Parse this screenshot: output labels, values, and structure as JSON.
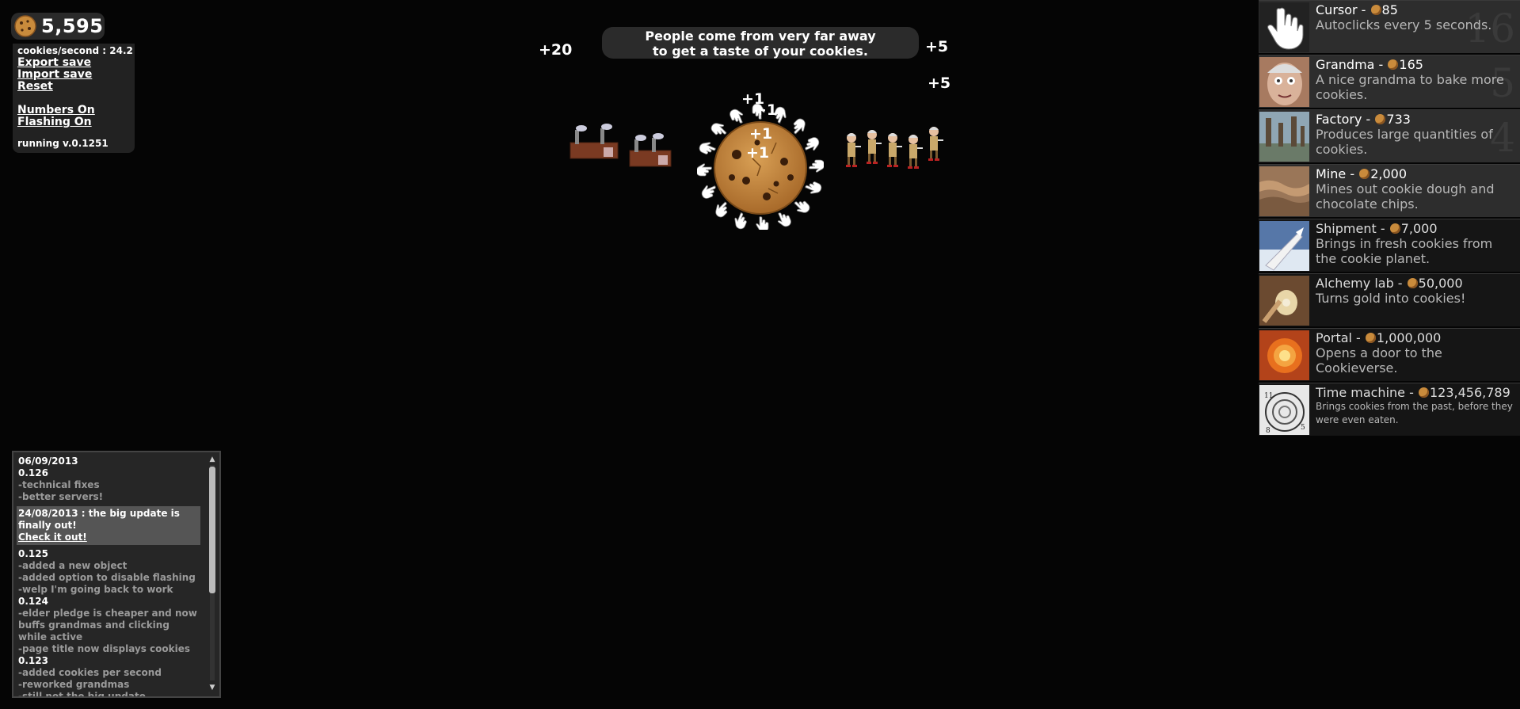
{
  "counter": {
    "cookies": "5,595"
  },
  "info": {
    "cps": "cookies/second : 24.2",
    "export": "Export save",
    "import": "Import save",
    "reset": "Reset",
    "numbers": "Numbers On",
    "flashing": "Flashing On",
    "version": "running v.0.1251"
  },
  "ticker": {
    "line1": "People come from very far away",
    "line2": "to get a taste of your cookies."
  },
  "floats": {
    "a": "+20",
    "b": "+5",
    "c": "+5",
    "d": "+1",
    "e": "+1",
    "f": "+1",
    "g": "+1"
  },
  "store": [
    {
      "name": "Cursor - ",
      "price": "85",
      "desc": "Autoclicks every 5 seconds.",
      "owned": "16",
      "icon": "cursor-icon",
      "dim": false
    },
    {
      "name": "Grandma - ",
      "price": "165",
      "desc": "A nice grandma to bake more cookies.",
      "owned": "5",
      "icon": "grandma-icon",
      "dim": false
    },
    {
      "name": "Factory - ",
      "price": "733",
      "desc": "Produces large quantities of cookies.",
      "owned": "4",
      "icon": "factory-icon",
      "dim": false
    },
    {
      "name": "Mine - ",
      "price": "2,000",
      "desc": "Mines out cookie dough and chocolate chips.",
      "owned": "",
      "icon": "mine-icon",
      "dim": false
    },
    {
      "name": "Shipment - ",
      "price": "7,000",
      "desc": "Brings in fresh cookies from the cookie planet.",
      "owned": "",
      "icon": "shipment-icon",
      "dim": true
    },
    {
      "name": "Alchemy lab - ",
      "price": "50,000",
      "desc": "Turns gold into cookies!",
      "owned": "",
      "icon": "alchemy-lab-icon",
      "dim": true
    },
    {
      "name": "Portal - ",
      "price": "1,000,000",
      "desc": "Opens a door to the Cookieverse.",
      "owned": "",
      "icon": "portal-icon",
      "dim": true
    },
    {
      "name": "Time machine - ",
      "price": "123,456,789",
      "desc": "Brings cookies from the past, before they were even eaten.",
      "owned": "",
      "icon": "time-machine-icon",
      "dim": true
    }
  ],
  "log": {
    "entries": [
      {
        "t": "date",
        "text": "06/09/2013"
      },
      {
        "t": "ver",
        "text": "0.126"
      },
      {
        "t": "line",
        "text": "-technical fixes"
      },
      {
        "t": "line",
        "text": "-better servers!"
      }
    ],
    "highlight": {
      "text": "24/08/2013 : the big update is finally out!",
      "link": "Check it out!"
    },
    "entries2": [
      {
        "t": "ver",
        "text": "0.125"
      },
      {
        "t": "line",
        "text": "-added a new object"
      },
      {
        "t": "line",
        "text": "-added option to disable flashing"
      },
      {
        "t": "line",
        "text": "-welp I'm going back to work"
      },
      {
        "t": "ver",
        "text": "0.124"
      },
      {
        "t": "line",
        "text": "-elder pledge is cheaper and now buffs grandmas and clicking while active"
      },
      {
        "t": "line",
        "text": "-page title now displays cookies"
      },
      {
        "t": "ver",
        "text": "0.123"
      },
      {
        "t": "line",
        "text": "-added cookies per second"
      },
      {
        "t": "line",
        "text": "-reworked grandmas"
      },
      {
        "t": "line",
        "text": "-still not the big update"
      }
    ]
  },
  "colors": {
    "background": "#050505",
    "panel": "#2d2d2d",
    "panel_dim": "#151515",
    "cookie": "#c98b3c"
  }
}
